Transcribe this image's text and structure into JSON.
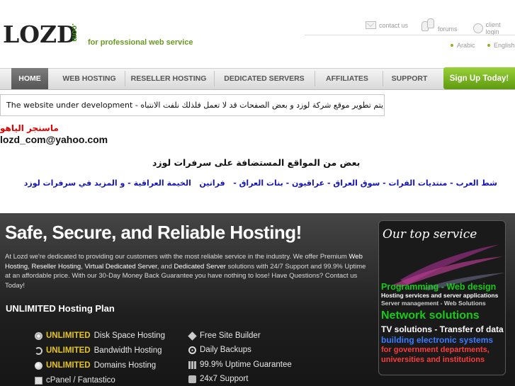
{
  "header": {
    "logo_text": "LOZD",
    "logo_suffix": ".com",
    "tagline": "for professional web service",
    "links": {
      "contact": "contact us",
      "forums": "forums",
      "client": "client login"
    },
    "languages": [
      "Arabic",
      "English"
    ]
  },
  "nav": {
    "items": [
      "HOME",
      "WEB HOSTING",
      "RESELLER HOSTING",
      "DEDICATED SERVERS",
      "AFFILIATES",
      "SUPPORT"
    ],
    "signup": "Sign Up Today!"
  },
  "notice": "The website under development - يتم تطوير موقع شركة لوزد و بعض الصفحات قد لا تعمل فلذلك نلفت الانتباه",
  "messenger": {
    "label": "ماسنجر الياهو",
    "email": "lozd_com@yahoo.com"
  },
  "hosted_sites": {
    "heading": "بعض من المواقع المستضافة على سرفرات لوزد",
    "links": [
      "شط العرب",
      "منتديات الفرات",
      "سوق العراق",
      "عراقيون",
      "بنات العراق",
      "فراتين",
      "الخيمة العراقية",
      "و المزيد في سرفرات لوزد"
    ]
  },
  "hero": {
    "title": "Safe, Secure, and Reliable Hosting!",
    "text_parts": [
      "At Lozd we're dedicated to providing our customers with the most reliable service in the industry. We offer Premium ",
      "Web Hosting",
      ", ",
      "Reseller Hosting",
      ", ",
      "Virtual Dedicated Server",
      ", and ",
      "Dedicated Server",
      " solutions with 24/7 Support and 99.9% Uptime at an affordable price. With our 30-Day Money Back Guarantee you have nothing to lose! Have Questions? Contact us Today!"
    ],
    "plan_title": "UNLIMITED Hosting Plan",
    "features_left": [
      {
        "highlight": "UNLIMITED",
        "text": "Disk Space Hosting",
        "icon": "disk-icon"
      },
      {
        "highlight": "UNLIMITED",
        "text": "Bandwidth Hosting",
        "icon": "bandwidth-icon"
      },
      {
        "highlight": "UNLIMITED",
        "text": "Domains Hosting",
        "icon": "globe-icon"
      },
      {
        "highlight": "",
        "text": "cPanel / Fantastico",
        "icon": "panel-icon"
      }
    ],
    "features_right": [
      {
        "text": "Free Site Builder",
        "icon": "builder-icon"
      },
      {
        "text": "Daily Backups",
        "icon": "backup-icon"
      },
      {
        "text": "99.9% Uptime Guarantee",
        "icon": "uptime-icon"
      },
      {
        "text": "24x7 Support",
        "icon": "support-icon"
      }
    ]
  },
  "promo": {
    "title": "Our top service",
    "lines": [
      {
        "text": "Programming - Web design",
        "color": "#18c918"
      },
      {
        "text": "Hosting services and server applications",
        "color": "#ffffff"
      },
      {
        "text": "Server management - Web Solutions",
        "color": "#cfcfcf"
      },
      {
        "text": "Network solutions",
        "color": "#18c918"
      },
      {
        "text": "TV solutions - Transfer of data",
        "color": "#ffffff"
      },
      {
        "text": "building electronic systems",
        "color": "#3b7bff"
      },
      {
        "text": "for government departments,",
        "color": "#ff3a3a"
      },
      {
        "text": "universities and institutions",
        "color": "#ff3a3a"
      }
    ]
  },
  "colors": {
    "accent_green": "#6a9a20",
    "nav_active": "#666666",
    "signup_green": "#7cbb22",
    "arabic_link": "#1616b4",
    "red_text": "#e00000",
    "hero_highlight": "#e5c51b"
  }
}
